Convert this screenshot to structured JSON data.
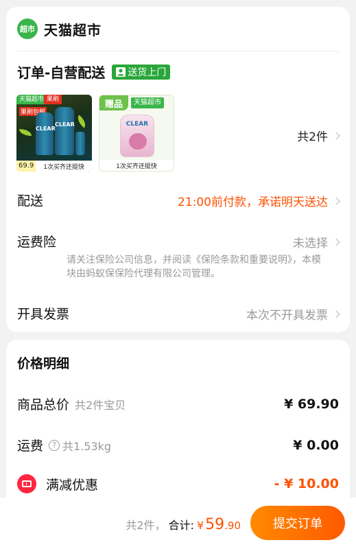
{
  "store": {
    "logo_text": "超市",
    "name": "天猫超市"
  },
  "order": {
    "title": "订单-自营配送",
    "delivery_tag": "送货上门"
  },
  "products": [
    {
      "store_badge": "天猫超市",
      "promo_badge": "果刷",
      "brand": "CLEAR",
      "promo_text": "果刷包邮",
      "price": "69.9",
      "caption": "1次买齐还挺快"
    },
    {
      "gift_badge": "赠品",
      "store_badge": "天猫超市",
      "brand": "CLEAR",
      "caption": "1次买齐还挺快"
    }
  ],
  "item_count": "共2件",
  "rows": {
    "delivery": {
      "label": "配送",
      "value": "21:00前付款，承诺明天送达"
    },
    "insurance": {
      "label": "运费险",
      "value": "未选择",
      "note": "请关注保险公司信息，并阅读《保险条款和重要说明》，本模块由蚂蚁保保险代理有限公司管理。"
    },
    "invoice": {
      "label": "开具发票",
      "value": "本次不开具发票"
    }
  },
  "price_detail": {
    "title": "价格明细",
    "goods": {
      "label": "商品总价",
      "sub": "共2件宝贝",
      "amount": "¥ 69.90"
    },
    "shipping": {
      "label": "运费",
      "help": "?",
      "sub": "共1.53kg",
      "amount": "¥ 0.00"
    },
    "discount": {
      "label": "满减优惠",
      "amount": "- ¥ 10.00"
    }
  },
  "footer": {
    "count": "共2件，",
    "total_label": "合计:",
    "currency": "¥",
    "total_int": "59",
    "total_dec": ".90",
    "submit": "提交订单"
  },
  "colors": {
    "accent": "#ff5000",
    "brand_green": "#39b54a",
    "discount_red": "#ff2640"
  }
}
